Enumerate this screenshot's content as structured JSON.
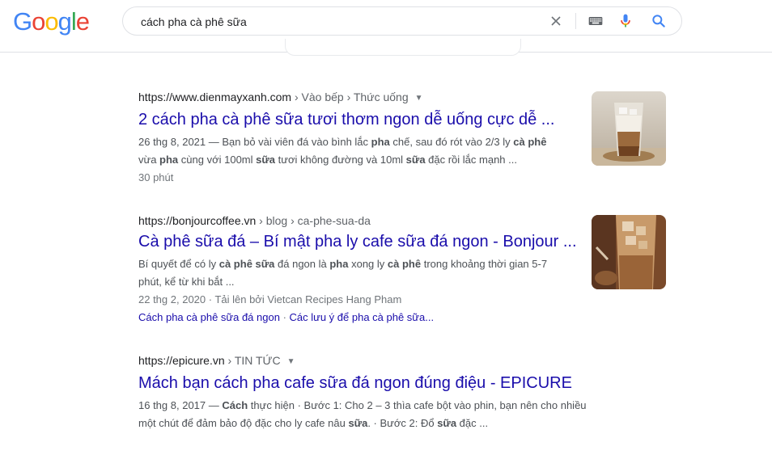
{
  "header": {
    "logo_letters": [
      "G",
      "o",
      "o",
      "g",
      "l",
      "e"
    ],
    "logo_colors": [
      "#4285F4",
      "#EA4335",
      "#FBBC05",
      "#4285F4",
      "#34A853",
      "#EA4335"
    ],
    "search_query": "cách pha cà phê sữa",
    "icons": [
      "clear-icon",
      "keyboard-icon",
      "microphone-icon",
      "search-icon"
    ]
  },
  "results": [
    {
      "site": "https://www.dienmayxanh.com",
      "path": " › Vào bếp › Thức uống",
      "title": "2 cách pha cà phê sữa tươi thơm ngon dễ uống cực dễ ...",
      "snippet_lines": [
        [
          {
            "t": "26 thg 8, 2021 — Bạn bỏ vài viên đá vào bình lắc ",
            "b": false
          },
          {
            "t": "pha",
            "b": true
          },
          {
            "t": " chế, sau đó rót vào 2/3 ly ",
            "b": false
          },
          {
            "t": "cà phê",
            "b": true
          }
        ],
        [
          {
            "t": "vừa ",
            "b": false
          },
          {
            "t": "pha",
            "b": true
          },
          {
            "t": " cùng với 100ml ",
            "b": false
          },
          {
            "t": "sữa",
            "b": true
          },
          {
            "t": " tươi không đường và 10ml ",
            "b": false
          },
          {
            "t": "sữa",
            "b": true
          },
          {
            "t": " đặc rồi lắc mạnh ...",
            "b": false
          }
        ]
      ],
      "meta": "30 phút",
      "thumbnail": "iced-milk-coffee-glass"
    },
    {
      "site": "https://bonjourcoffee.vn",
      "path": " › blog › ca-phe-sua-da",
      "title": "Cà phê sữa đá – Bí mật pha ly cafe sữa đá ngon - Bonjour ...",
      "snippet_lines": [
        [
          {
            "t": "Bí quyết để có ly ",
            "b": false
          },
          {
            "t": "cà phê sữa",
            "b": true
          },
          {
            "t": " đá ngon là ",
            "b": false
          },
          {
            "t": "pha",
            "b": true
          },
          {
            "t": " xong ly ",
            "b": false
          },
          {
            "t": "cà phê",
            "b": true
          },
          {
            "t": " trong khoảng thời gian 5-7",
            "b": false
          }
        ],
        [
          {
            "t": "phút, kể từ khi bắt ...",
            "b": false
          }
        ]
      ],
      "meta": "22 thg 2, 2020 · Tải lên bởi Vietcan Recipes Hang Pham",
      "sitelinks": [
        "Cách pha cà phê sữa đá ngon",
        "Các lưu ý để pha cà phê sữa..."
      ],
      "sitelink_sep": " · ",
      "thumbnail": "iced-coffee-with-ice-cubes"
    },
    {
      "site": "https://epicure.vn",
      "path": " › TIN TỨC",
      "title": "Mách bạn cách pha cafe sữa đá ngon đúng điệu - EPICURE",
      "snippet_lines": [
        [
          {
            "t": "16 thg 8, 2017 — ",
            "b": false
          },
          {
            "t": "Cách",
            "b": true
          },
          {
            "t": " thực hiện · Bước 1: Cho 2 – 3 thìa cafe bột vào phin, bạn nên cho nhiều",
            "b": false
          }
        ],
        [
          {
            "t": "một chút để đảm bảo độ đặc cho ly cafe nâu ",
            "b": false
          },
          {
            "t": "sữa",
            "b": true
          },
          {
            "t": ". · Bước 2: Đổ ",
            "b": false
          },
          {
            "t": "sữa",
            "b": true
          },
          {
            "t": " đặc ...",
            "b": false
          }
        ]
      ]
    }
  ]
}
